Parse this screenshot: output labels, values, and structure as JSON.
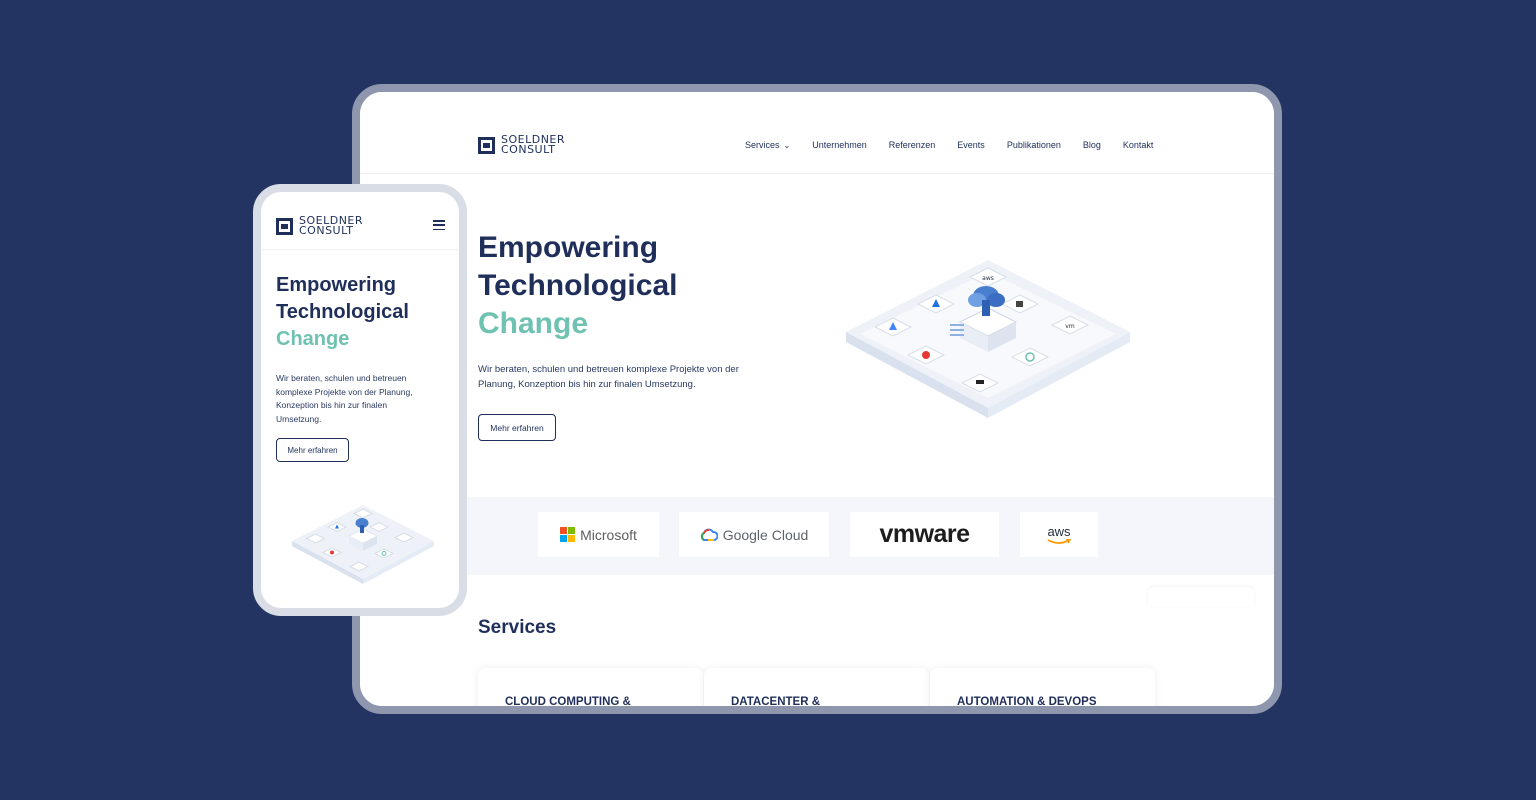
{
  "brand": {
    "line1": "SOELDNER",
    "line2": "CONSULT"
  },
  "nav": {
    "items": [
      "Services",
      "Unternehmen",
      "Referenzen",
      "Events",
      "Publikationen",
      "Blog",
      "Kontakt"
    ],
    "services_chevron_icon": "chevron-down-icon"
  },
  "hero": {
    "title_line1": "Empowering",
    "title_line2": "Technological",
    "title_line3": "Change",
    "text": "Wir beraten, schulen und betreuen komplexe Projekte von der Planung, Konzeption bis hin zur finalen Umsetzung.",
    "button": "Mehr erfahren"
  },
  "partners": {
    "microsoft": "Microsoft",
    "google_cloud": "Google Cloud",
    "vmware": "vmware",
    "aws": "aws"
  },
  "services": {
    "title": "Services",
    "cards": [
      "CLOUD COMPUTING &",
      "DATACENTER &",
      "AUTOMATION & DEVOPS"
    ]
  },
  "colors": {
    "background": "#233462",
    "navy": "#1f2f5a",
    "teal": "#6fc2b2",
    "frame_desktop": "#8e97ae",
    "frame_mobile": "#d9dde6"
  },
  "icons": {
    "menu": "hamburger-menu-icon",
    "illustration": "cloud-platform-illustration"
  }
}
